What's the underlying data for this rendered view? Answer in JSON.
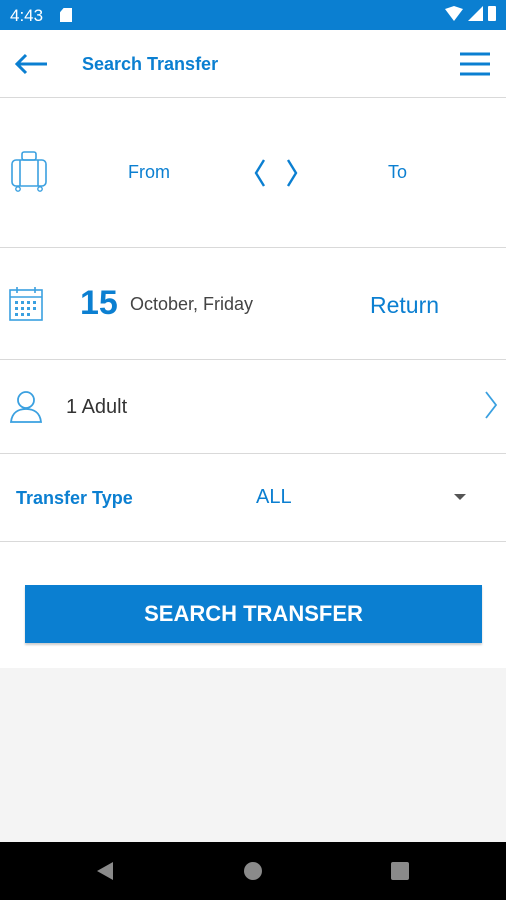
{
  "status_bar": {
    "time": "4:43",
    "icons": [
      "sd-card-icon",
      "wifi-icon",
      "signal-icon",
      "battery-icon"
    ]
  },
  "header": {
    "title": "Search Transfer",
    "back_icon": "arrow-left-icon",
    "menu_icon": "hamburger-menu-icon"
  },
  "route": {
    "from_label": "From",
    "to_label": "To",
    "swap_icon": "swap-chevrons-icon",
    "luggage_icon": "luggage-icon"
  },
  "date": {
    "day": "15",
    "month_weekday": "October, Friday",
    "return_label": "Return",
    "calendar_icon": "calendar-icon"
  },
  "passengers": {
    "label": "1 Adult",
    "user_icon": "user-icon"
  },
  "transfer_type": {
    "label": "Transfer Type",
    "selected": "ALL"
  },
  "search_button": {
    "label": "SEARCH TRANSFER"
  },
  "nav_bar": {
    "icons": [
      "back-triangle-icon",
      "home-circle-icon",
      "recents-square-icon"
    ]
  },
  "colors": {
    "primary": "#0b7fd1",
    "divider": "#d9d9d9",
    "background": "#f4f4f4"
  }
}
